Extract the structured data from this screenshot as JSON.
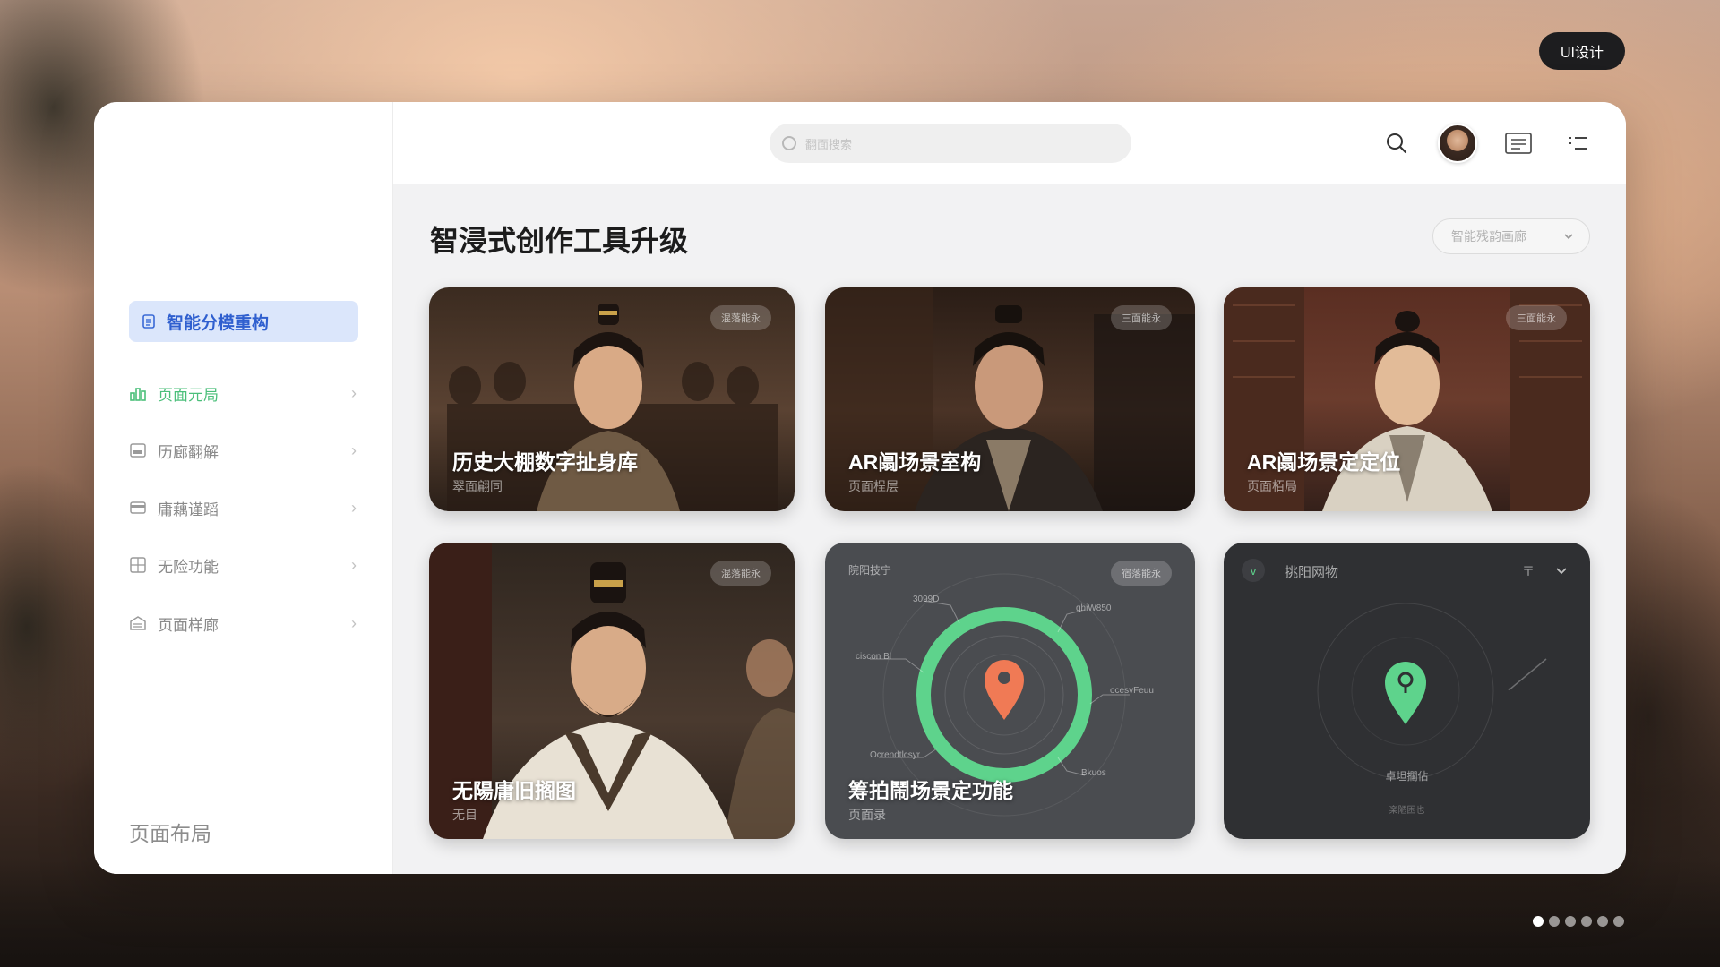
{
  "corner_tag": "UI设计",
  "search": {
    "placeholder": "翻面搜索"
  },
  "sidebar": {
    "active": {
      "label": "智能分模重构",
      "icon": "document-icon"
    },
    "items": [
      {
        "label": "页面元局",
        "icon": "chart-icon"
      },
      {
        "label": "历廊翻解",
        "icon": "image-icon"
      },
      {
        "label": "庸藕谨蹈",
        "icon": "card-icon"
      },
      {
        "label": "无险功能",
        "icon": "grid-icon"
      },
      {
        "label": "页面样廊",
        "icon": "stack-icon"
      }
    ],
    "footer": "页面布局"
  },
  "main": {
    "title": "智浸式创作工具升级",
    "dropdown_label": "智能残韵画廊"
  },
  "cards": [
    {
      "title": "历史大棚数字扯身库",
      "subtitle": "翠面翩同",
      "badge": "混落能永"
    },
    {
      "title": "AR阘场景室构",
      "subtitle": "页面桯层",
      "badge": "三面能永"
    },
    {
      "title": "AR阘场景定定位",
      "subtitle": "页面栢局",
      "badge": "三面能永"
    },
    {
      "title": "无陽庸旧搁图",
      "subtitle": "无目",
      "badge": "混落能永"
    },
    {
      "title": "筹拍鬧场景定功能",
      "subtitle": "页面录",
      "badge": "宿落能永",
      "header": "院阳技宁",
      "labels": [
        "3099D",
        "ghiW850",
        "ciscon Bl",
        "ocesvFeuu",
        "Ocrendtlcsyr",
        "Bkuos"
      ],
      "accent": "#5ed38c",
      "pin_color": "#f07a55"
    },
    {
      "title": "",
      "header": "挑阳网物",
      "header_right": "〒",
      "caption": "卓坦擱佔",
      "caption2": "楽陋困也",
      "pin_color": "#5ed38c"
    }
  ],
  "pager": {
    "count": 6,
    "active_index": 0
  }
}
